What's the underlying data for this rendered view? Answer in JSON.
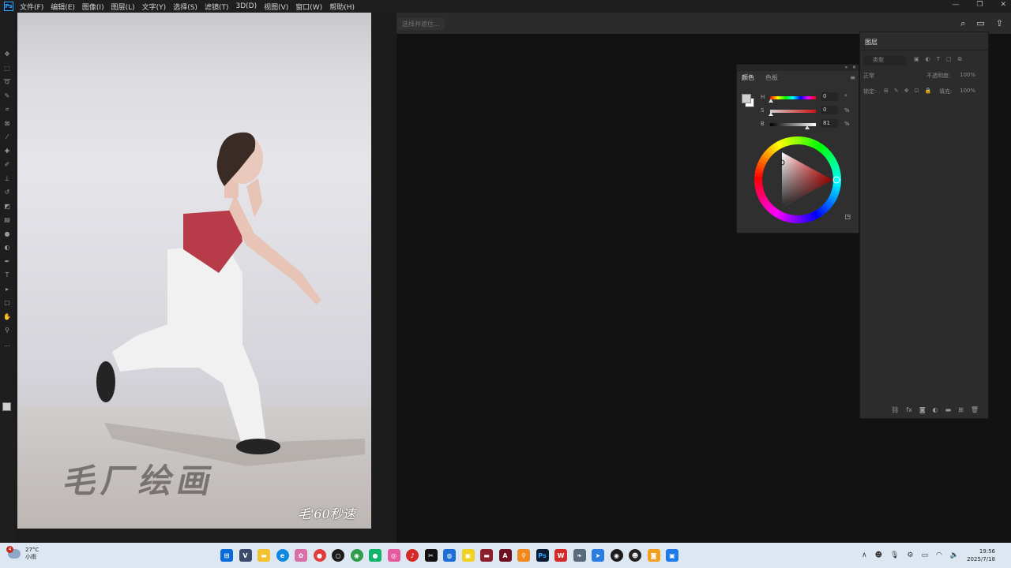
{
  "menu": {
    "logo": "Ps",
    "items": [
      "文件(F)",
      "编辑(E)",
      "图像(I)",
      "图层(L)",
      "文字(Y)",
      "选择(S)",
      "滤镜(T)",
      "3D(D)",
      "视图(V)",
      "窗口(W)",
      "帮助(H)"
    ]
  },
  "window_controls": {
    "minimize": "—",
    "restore": "❐",
    "close": "✕"
  },
  "options_bar": {
    "hint": "选择并遮住..."
  },
  "canvas": {
    "watermark": "毛'60秒速",
    "floor_text": "毛厂绘画"
  },
  "color_panel": {
    "tabs": [
      "颜色",
      "色板"
    ],
    "h": {
      "label": "H",
      "value": "0",
      "unit": "°"
    },
    "s": {
      "label": "S",
      "value": "0",
      "unit": "%"
    },
    "b": {
      "label": "B",
      "value": "81",
      "unit": "%"
    },
    "foreground": "#cfcfcf",
    "background": "#ffffff"
  },
  "layers_panel": {
    "title": "图层",
    "search_placeholder": "类型",
    "blend_mode": "正常",
    "opacity_label": "不透明度:",
    "opacity_value": "100%",
    "lock_label": "锁定:",
    "fill_label": "填充:",
    "fill_value": "100%",
    "bottom_icons": [
      "link-icon",
      "fx-icon",
      "mask-icon",
      "adjustment-icon",
      "folder-icon",
      "new-layer-icon",
      "trash-icon"
    ]
  },
  "taskbar": {
    "weather_temp": "27°C",
    "weather_desc": "小雨",
    "weather_badge": "4",
    "clock_time": "19:56",
    "clock_date": "2025/7/18"
  }
}
